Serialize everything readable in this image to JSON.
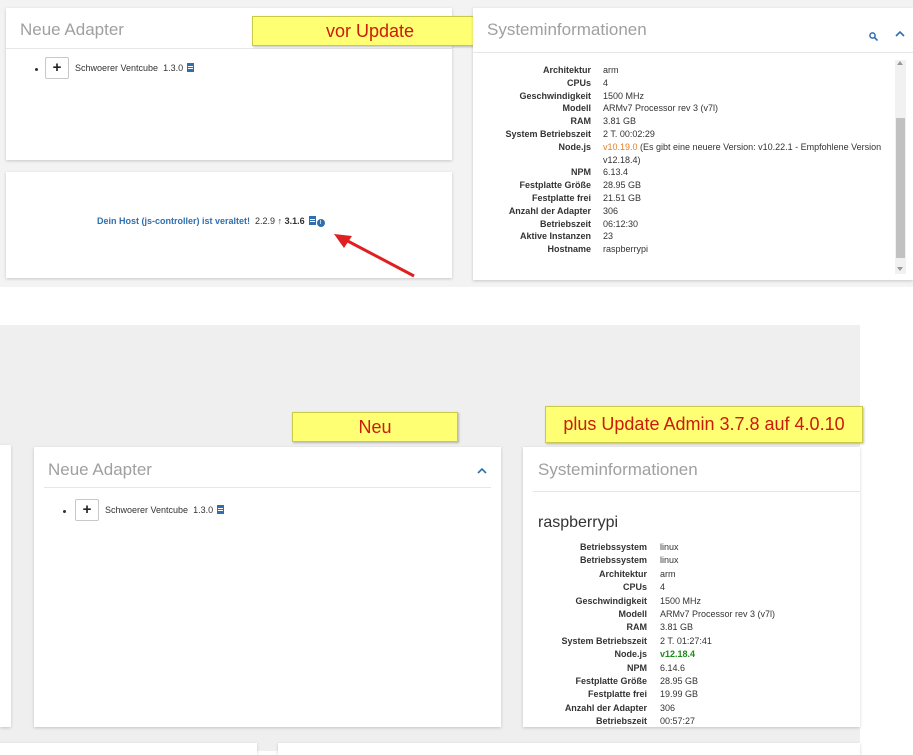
{
  "top": {
    "neue_adapter": {
      "title": "Neue Adapter",
      "adapter_name": "Schwoerer Ventcube",
      "adapter_version": "1.3.0",
      "plus": "+"
    },
    "note_label": "vor Update",
    "host_warning": {
      "text": "Dein Host (js-controller) ist veraltet!",
      "old_version": "2.2.9",
      "new_version": "3.1.6"
    },
    "sysinfo": {
      "title": "Systeminformationen",
      "rows": [
        {
          "label": "Architektur",
          "value": "arm"
        },
        {
          "label": "CPUs",
          "value": "4"
        },
        {
          "label": "Geschwindigkeit",
          "value": "1500 MHz"
        },
        {
          "label": "Modell",
          "value": "ARMv7 Processor rev 3 (v7l)"
        },
        {
          "label": "RAM",
          "value": "3.81 GB"
        },
        {
          "label": "System Betriebszeit",
          "value": "2 T. 00:02:29"
        },
        {
          "label": "Node.js",
          "value": "v10.19.0",
          "value_extra": "(Es gibt eine neuere Version: v10.22.1 - Empfohlene Version",
          "value_extra2": "v12.18.4)"
        },
        {
          "label": "NPM",
          "value": "6.13.4"
        },
        {
          "label": "Festplatte Größe",
          "value": "28.95 GB"
        },
        {
          "label": "Festplatte frei",
          "value": "21.51 GB"
        },
        {
          "label": "Anzahl der Adapter",
          "value": "306"
        },
        {
          "label": "Betriebszeit",
          "value": "06:12:30"
        },
        {
          "label": "Aktive Instanzen",
          "value": "23"
        },
        {
          "label": "Hostname",
          "value": "raspberrypi"
        }
      ]
    }
  },
  "bottom": {
    "note_neu": "Neu",
    "note_update": "plus Update Admin 3.7.8 auf 4.0.10",
    "neue_adapter": {
      "title": "Neue Adapter",
      "adapter_name": "Schwoerer Ventcube",
      "adapter_version": "1.3.0",
      "plus": "+"
    },
    "sysinfo": {
      "title": "Systeminformationen",
      "hostname": "raspberrypi",
      "rows": [
        {
          "label": "Betriebssystem",
          "value": "linux"
        },
        {
          "label": "Betriebssystem",
          "value": "linux"
        },
        {
          "label": "Architektur",
          "value": "arm"
        },
        {
          "label": "CPUs",
          "value": "4"
        },
        {
          "label": "Geschwindigkeit",
          "value": "1500 MHz"
        },
        {
          "label": "Modell",
          "value": "ARMv7 Processor rev 3 (v7l)"
        },
        {
          "label": "RAM",
          "value": "3.81 GB"
        },
        {
          "label": "System Betriebszeit",
          "value": "2 T. 01:27:41"
        },
        {
          "label": "Node.js",
          "value": "v12.18.4"
        },
        {
          "label": "NPM",
          "value": "6.14.6"
        },
        {
          "label": "Festplatte Größe",
          "value": "28.95 GB"
        },
        {
          "label": "Festplatte frei",
          "value": "19.99 GB"
        },
        {
          "label": "Anzahl der Adapter",
          "value": "306"
        },
        {
          "label": "Betriebszeit",
          "value": "00:57:27"
        }
      ]
    }
  },
  "colors": {
    "note_bg": "#ffff73",
    "note_text": "#cc1a0b",
    "link_blue": "#2f6fb0",
    "node_orange": "#e67e22",
    "node_green": "#1e8a1e",
    "arrow_red": "#e02020"
  }
}
